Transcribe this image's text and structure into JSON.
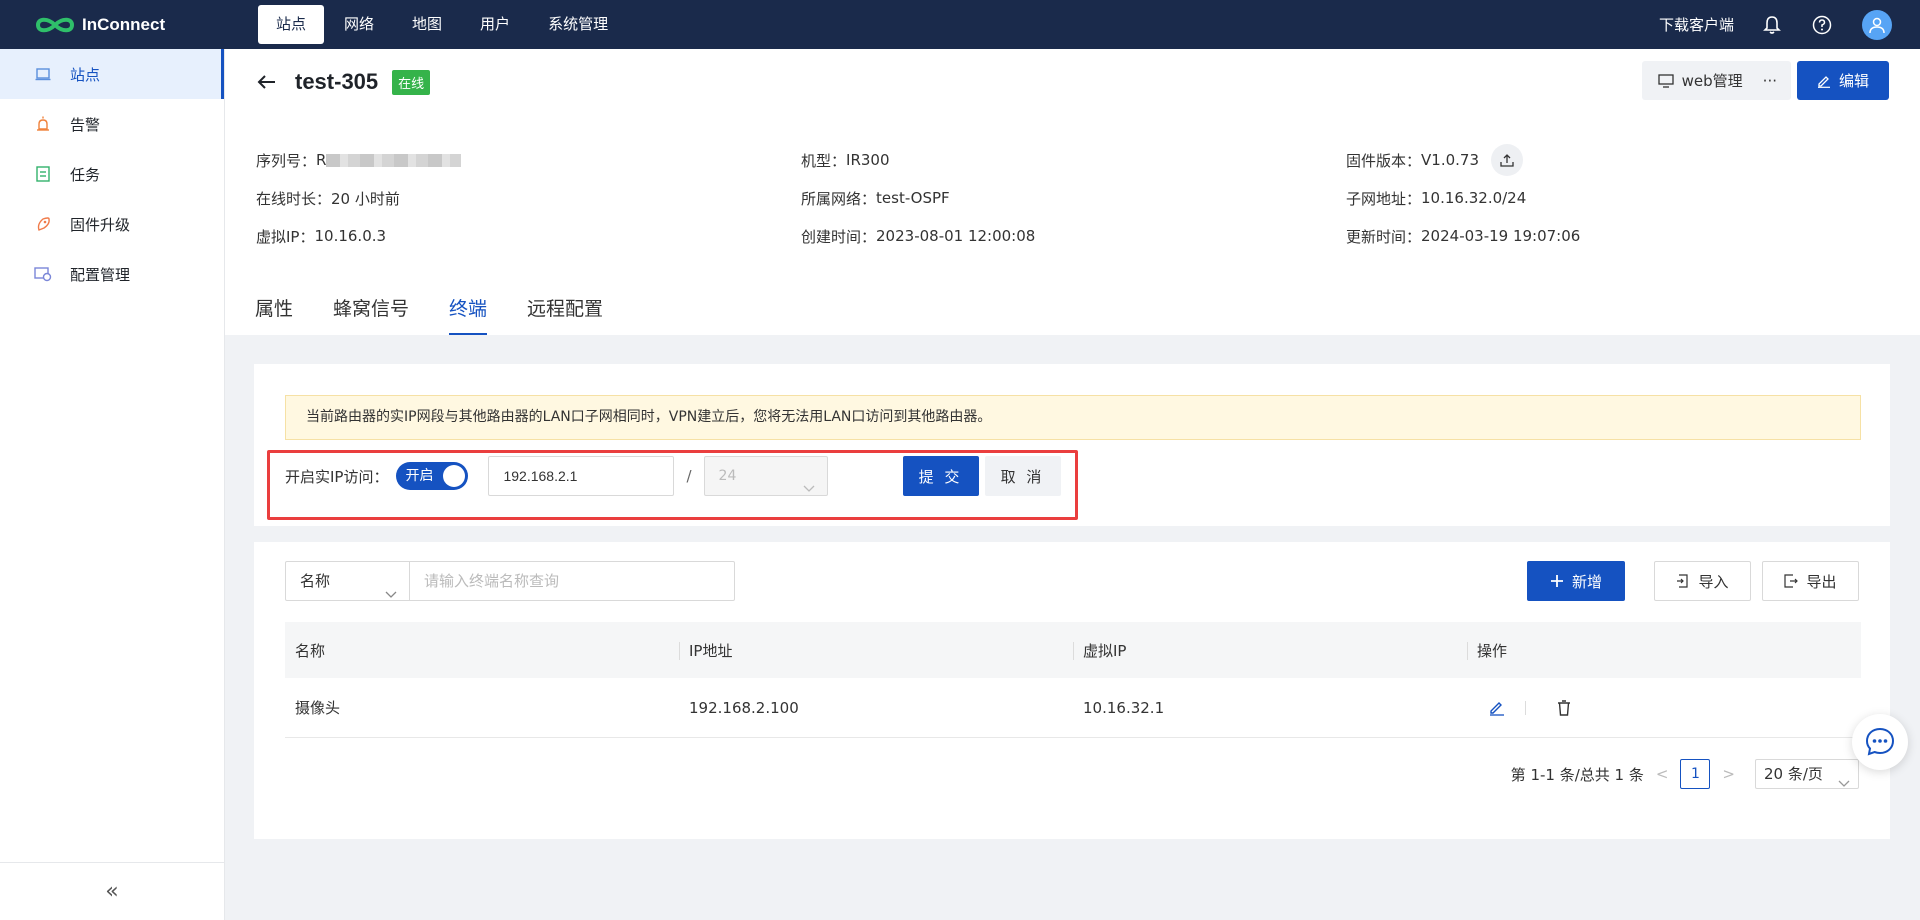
{
  "app": {
    "name": "InConnect",
    "brand_color": "#1552c1",
    "topbar_color": "#1a2a4b"
  },
  "topnav": {
    "items": [
      {
        "label": "站点",
        "active": true
      },
      {
        "label": "网络"
      },
      {
        "label": "地图"
      },
      {
        "label": "用户"
      },
      {
        "label": "系统管理"
      }
    ],
    "download_label": "下载客户端",
    "icons": [
      "bell-icon",
      "help-icon",
      "user-avatar-icon"
    ]
  },
  "sidebar": {
    "items": [
      {
        "label": "站点",
        "icon": "site-icon",
        "active": true
      },
      {
        "label": "告警",
        "icon": "alarm-icon"
      },
      {
        "label": "任务",
        "icon": "task-icon"
      },
      {
        "label": "固件升级",
        "icon": "firmware-icon"
      },
      {
        "label": "配置管理",
        "icon": "config-icon"
      }
    ],
    "collapse_label": "«"
  },
  "device": {
    "name": "test-305",
    "status": "在线",
    "web_manage_label": "web管理",
    "more_label": "···",
    "edit_label": "编辑",
    "info": {
      "serial_label": "序列号：",
      "serial_value": "R",
      "model_label": "机型：",
      "model_value": "IR300",
      "firmware_label": "固件版本：",
      "firmware_value": "V1.0.73",
      "uptime_label": "在线时长：",
      "uptime_value": "20 小时前",
      "network_label": "所属网络：",
      "network_value": "test-OSPF",
      "subnet_label": "子网地址：",
      "subnet_value": "10.16.32.0/24",
      "vip_label": "虚拟IP：",
      "vip_value": "10.16.0.3",
      "created_label": "创建时间：",
      "created_value": "2023-08-01 12:00:08",
      "updated_label": "更新时间：",
      "updated_value": "2024-03-19 19:07:06"
    }
  },
  "tabs": [
    {
      "label": "属性"
    },
    {
      "label": "蜂窝信号"
    },
    {
      "label": "终端",
      "active": true
    },
    {
      "label": "远程配置"
    }
  ],
  "realip": {
    "notice": "当前路由器的实IP网段与其他路由器的LAN口子网相同时，VPN建立后，您将无法用LAN口访问到其他路由器。",
    "label": "开启实IP访问：",
    "switch_label": "开启",
    "ip_value": "192.168.2.1",
    "slash": "/",
    "mask_value": "24",
    "submit_label": "提 交",
    "cancel_label": "取 消"
  },
  "terminals": {
    "filter_field": "名称",
    "search_placeholder": "请输入终端名称查询",
    "add_label": "新增",
    "import_label": "导入",
    "export_label": "导出",
    "columns": [
      "名称",
      "IP地址",
      "虚拟IP",
      "操作"
    ],
    "rows": [
      {
        "name": "摄像头",
        "ip": "192.168.2.100",
        "vip": "10.16.32.1"
      }
    ],
    "pager": {
      "summary": "第 1-1 条/总共 1 条",
      "current_page": "1",
      "page_size": "20 条/页"
    }
  }
}
